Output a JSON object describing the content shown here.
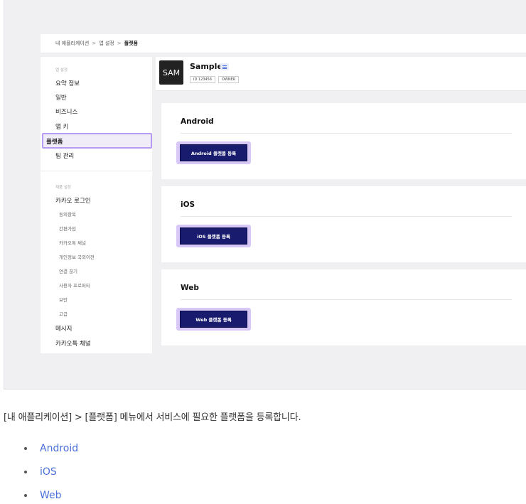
{
  "breadcrumb": {
    "items": [
      "내 애플리케이션",
      "앱 설정",
      "플랫폼"
    ],
    "sep": ">"
  },
  "sidebar": {
    "group1_title": "앱 설정",
    "items1": [
      "요약 정보",
      "일반",
      "비즈니스",
      "앱 키",
      "플랫폼",
      "팀 관리"
    ],
    "group2_title": "제품 설정",
    "item_kakao_login": "카카오 로그인",
    "sub_items": [
      "동의항목",
      "간편가입",
      "카카오톡 채널",
      "개인정보 국외이전",
      "연결 끊기",
      "사용자 프로퍼티",
      "보안",
      "고급"
    ],
    "item_message": "메시지",
    "item_channel": "카카오톡 채널"
  },
  "app": {
    "icon_text": "SAM",
    "name": "Sample",
    "id_tag": "ID 123456",
    "role_tag": "OWNER"
  },
  "platforms": [
    {
      "title": "Android",
      "button": "Android 플랫폼 등록"
    },
    {
      "title": "iOS",
      "button": "iOS 플랫폼 등록"
    },
    {
      "title": "Web",
      "button": "Web 플랫폼 등록"
    }
  ],
  "description": "[내 애플리케이션] > [플랫폼] 메뉴에서 서비스에 필요한 플랫폼을 등록합니다.",
  "platform_links": [
    "Android",
    "iOS",
    "Web"
  ],
  "colors": {
    "primary_button": "#181b6e",
    "highlight": "#b59cf2",
    "link": "#4b6fd8"
  }
}
